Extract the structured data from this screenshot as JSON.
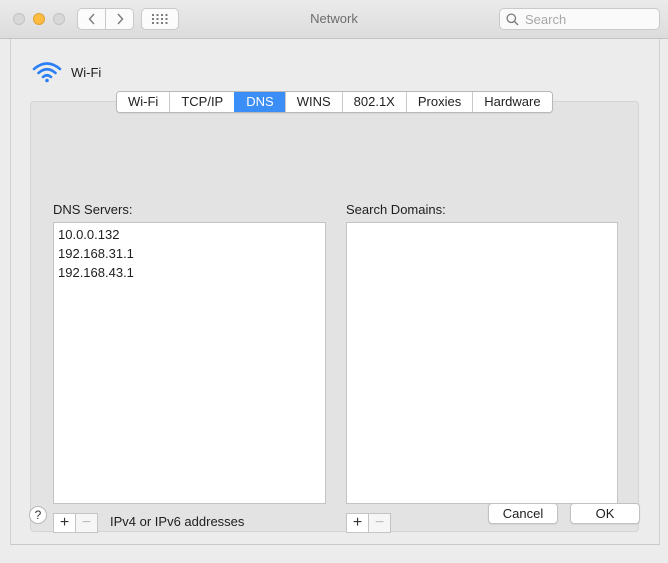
{
  "window": {
    "title": "Network"
  },
  "search": {
    "placeholder": "Search"
  },
  "service": {
    "name": "Wi-Fi"
  },
  "tabs": [
    {
      "label": "Wi-Fi",
      "active": false
    },
    {
      "label": "TCP/IP",
      "active": false
    },
    {
      "label": "DNS",
      "active": true
    },
    {
      "label": "WINS",
      "active": false
    },
    {
      "label": "802.1X",
      "active": false
    },
    {
      "label": "Proxies",
      "active": false
    },
    {
      "label": "Hardware",
      "active": false
    }
  ],
  "dns_servers": {
    "label": "DNS Servers:",
    "items": [
      "10.0.0.132",
      "192.168.31.1",
      "192.168.43.1"
    ],
    "add": "+",
    "remove": "−",
    "hint": "IPv4 or IPv6 addresses"
  },
  "search_domains": {
    "label": "Search Domains:",
    "items": [],
    "add": "+",
    "remove": "−"
  },
  "footer": {
    "help": "?",
    "cancel": "Cancel",
    "ok": "OK"
  },
  "colors": {
    "accent": "#3a8ef6",
    "wifi": "#2b7ff5"
  }
}
